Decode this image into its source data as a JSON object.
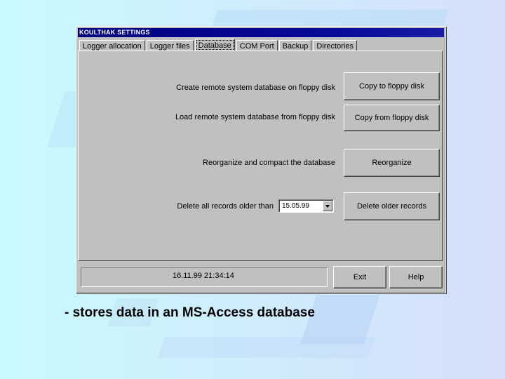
{
  "window": {
    "title": "KOULTHAK SETTINGS"
  },
  "tabs": [
    {
      "label": "Logger allocation"
    },
    {
      "label": "Logger files"
    },
    {
      "label": "Database"
    },
    {
      "label": "COM Port"
    },
    {
      "label": "Backup"
    },
    {
      "label": "Directories"
    }
  ],
  "active_tab": "Database",
  "database": {
    "copy_to_floppy": {
      "label": "Create remote system database on floppy disk",
      "button": "Copy to floppy disk"
    },
    "copy_from_floppy": {
      "label": "Load remote system database from floppy disk",
      "button": "Copy from floppy disk"
    },
    "reorganize": {
      "label": "Reorganize and compact the database",
      "button": "Reorganize"
    },
    "delete_older": {
      "label": "Delete all records older than",
      "date_value": "15.05.99",
      "button": "Delete older records"
    }
  },
  "status": {
    "timestamp": "16.11.99 21:34:14"
  },
  "footer_buttons": {
    "exit": "Exit",
    "help": "Help"
  },
  "caption": "- stores data in an MS-Access database",
  "colors": {
    "titlebar": "#000080",
    "window_face": "#c0c0c0",
    "background_left": "#c8fafd",
    "background_right": "#d6defa"
  }
}
